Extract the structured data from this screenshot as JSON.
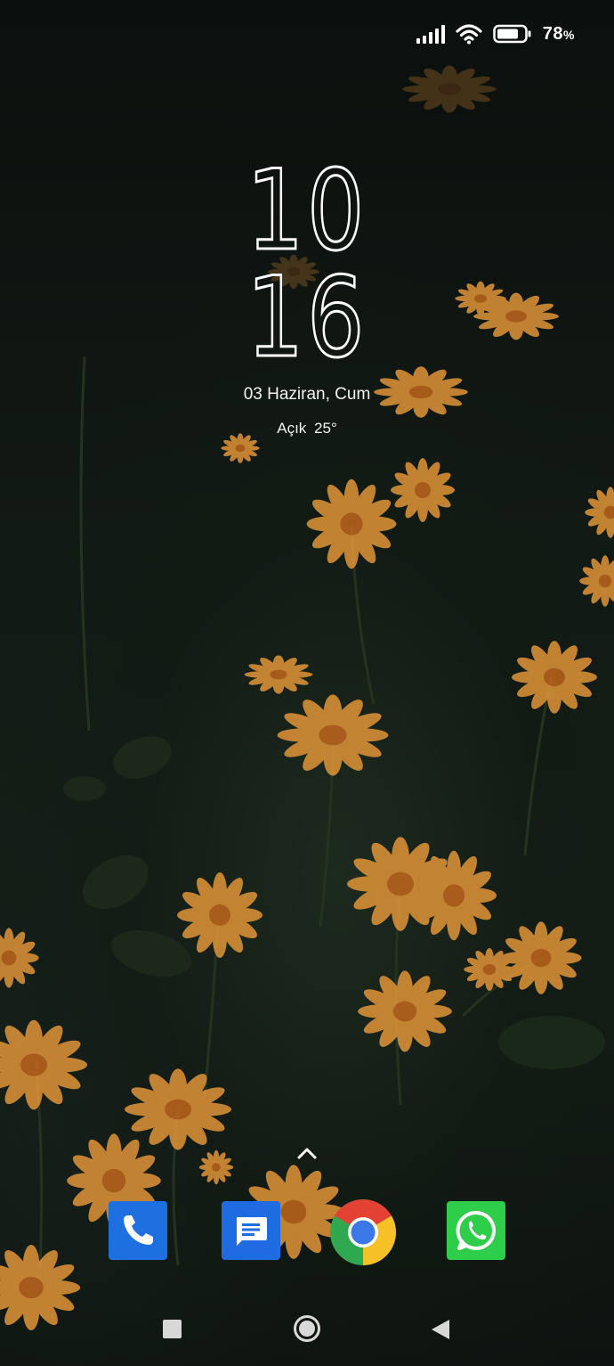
{
  "status_bar": {
    "battery_percent": "78",
    "battery_unit": "%",
    "icons": [
      "signal-icon",
      "wifi-icon",
      "battery-icon"
    ]
  },
  "lock_screen": {
    "clock_hours": "10",
    "clock_minutes": "16",
    "date": "03 Haziran, Cum",
    "weather": "Açık 25°"
  },
  "dock": {
    "apps": [
      "phone-icon",
      "messages-icon",
      "chrome-icon",
      "whatsapp-icon"
    ]
  },
  "navigation": {
    "buttons": [
      "recents-button",
      "home-button",
      "back-button"
    ]
  }
}
